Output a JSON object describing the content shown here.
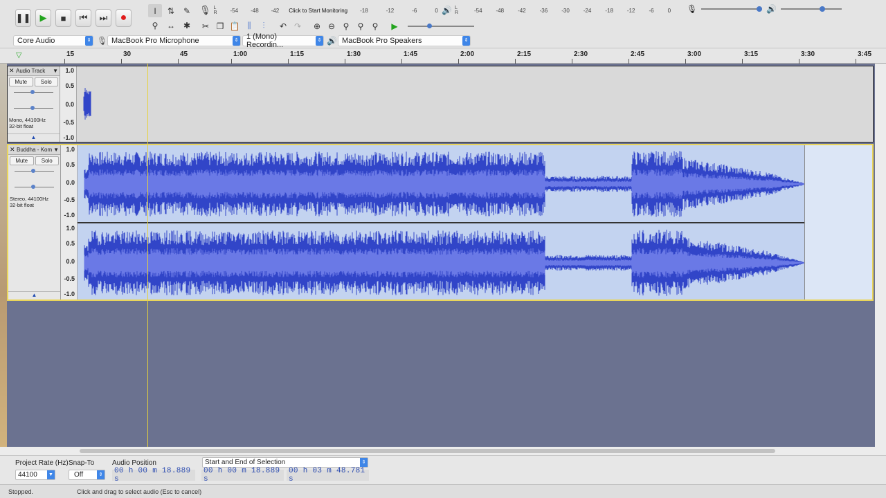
{
  "transport": {
    "pause_icon": "pause-icon",
    "play_icon": "play-icon",
    "stop_icon": "stop-icon",
    "skip_start_icon": "skip-start-icon",
    "skip_end_icon": "skip-end-icon",
    "record_icon": "record-icon"
  },
  "meters": {
    "record_hint": "Click to Start Monitoring",
    "record_scale": [
      "-54",
      "-48",
      "-42",
      "-18",
      "-12",
      "-6",
      "0"
    ],
    "play_scale": [
      "-54",
      "-48",
      "-42",
      "-36",
      "-30",
      "-24",
      "-18",
      "-12",
      "-6",
      "0"
    ]
  },
  "devices": {
    "host": "Core Audio",
    "input": "MacBook Pro Microphone",
    "channels": "1 (Mono) Recordin...",
    "output": "MacBook Pro Speakers"
  },
  "ruler": {
    "ticks": [
      "15",
      "30",
      "45",
      "1:00",
      "1:15",
      "1:30",
      "1:45",
      "2:00",
      "2:15",
      "2:30",
      "2:45",
      "3:00",
      "3:15",
      "3:30",
      "3:45"
    ]
  },
  "tracks": [
    {
      "name": "Audio Track",
      "mute": "Mute",
      "solo": "Solo",
      "info_line1": "Mono, 44100Hz",
      "info_line2": "32-bit float",
      "scale": [
        "1.0",
        "0.5",
        "0.0",
        "-0.5",
        "-1.0"
      ]
    },
    {
      "name": "Buddha - Kom",
      "mute": "Mute",
      "solo": "Solo",
      "info_line1": "Stereo, 44100Hz",
      "info_line2": "32-bit float",
      "scale": [
        "1.0",
        "0.5",
        "0.0",
        "-0.5",
        "-1.0"
      ]
    }
  ],
  "selection_bar": {
    "project_rate_label": "Project Rate (Hz)",
    "project_rate": "44100",
    "snap_to_label": "Snap-To",
    "snap_to": "Off",
    "audio_position_label": "Audio Position",
    "audio_position": "00 h 00 m 18.889 s",
    "selection_mode": "Start and End of Selection",
    "selection_start": "00 h 00 m 18.889 s",
    "selection_end": "00 h 03 m 48.781 s"
  },
  "status": {
    "state": "Stopped.",
    "hint": "Click and drag to select audio (Esc to cancel)"
  }
}
